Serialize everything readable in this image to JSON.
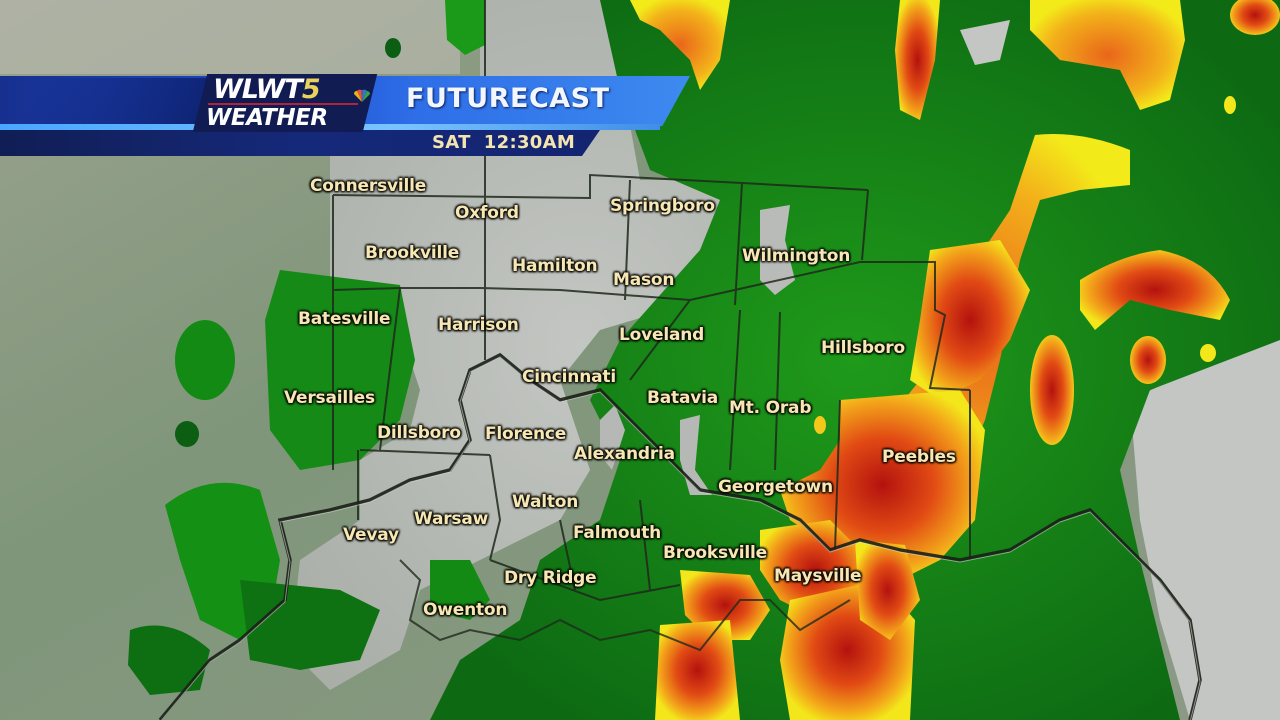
{
  "banner": {
    "station_logo_top": "WLWT",
    "station_logo_number": "5",
    "station_logo_bottom": "WEATHER",
    "network_icon": "nbc-peacock-icon",
    "product_title": "FUTURECAST",
    "forecast_time": "SAT  12:30AM"
  },
  "colors": {
    "banner_blue": "#1c45c4",
    "banner_light": "#3d8af0",
    "banner_dark": "#132470",
    "city_label": "#f6e7b4",
    "radar_light_green": "#1f9a1a",
    "radar_dark_green": "#0b5e12",
    "radar_yellow": "#f3e61a",
    "radar_orange": "#f08a1a",
    "radar_red": "#c8160f",
    "radar_dark_red": "#8a0c0c"
  },
  "map": {
    "cities": [
      {
        "name": "Connersville"
      },
      {
        "name": "Oxford"
      },
      {
        "name": "Springboro"
      },
      {
        "name": "Brookville"
      },
      {
        "name": "Hamilton"
      },
      {
        "name": "Mason"
      },
      {
        "name": "Wilmington"
      },
      {
        "name": "Batesville"
      },
      {
        "name": "Harrison"
      },
      {
        "name": "Loveland"
      },
      {
        "name": "Hillsboro"
      },
      {
        "name": "Cincinnati"
      },
      {
        "name": "Versailles"
      },
      {
        "name": "Batavia"
      },
      {
        "name": "Mt. Orab"
      },
      {
        "name": "Dillsboro"
      },
      {
        "name": "Florence"
      },
      {
        "name": "Alexandria"
      },
      {
        "name": "Peebles"
      },
      {
        "name": "Georgetown"
      },
      {
        "name": "Walton"
      },
      {
        "name": "Warsaw"
      },
      {
        "name": "Vevay"
      },
      {
        "name": "Falmouth"
      },
      {
        "name": "Brooksville"
      },
      {
        "name": "Maysville"
      },
      {
        "name": "Dry Ridge"
      },
      {
        "name": "Owenton"
      }
    ]
  }
}
